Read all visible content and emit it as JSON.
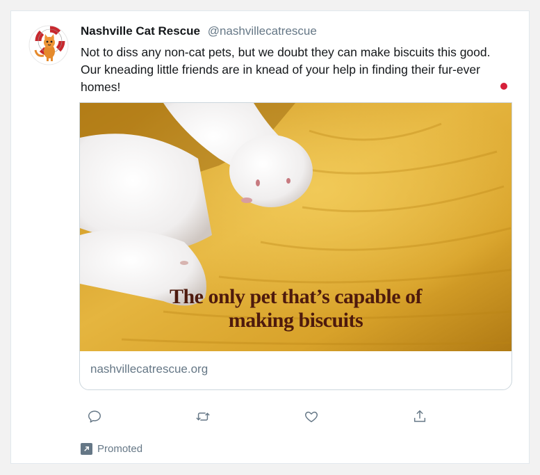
{
  "tweet": {
    "display_name": "Nashville Cat Rescue",
    "handle": "@nashvillecatrescue",
    "text": "Not to diss any non-cat pets, but we doubt they can make biscuits this good. Our kneading little friends are in knead of your help in finding their fur-ever homes!"
  },
  "card": {
    "overlay_line1": "The only pet that’s capable of",
    "overlay_line2": "making biscuits",
    "url": "nashvillecatrescue.org"
  },
  "promoted": {
    "label": "Promoted"
  },
  "icons": {
    "avatar": "cat-lifebuoy-logo",
    "reply": "reply-icon",
    "retweet": "retweet-icon",
    "like": "heart-icon",
    "share": "share-icon",
    "promoted": "promoted-arrow-icon"
  },
  "colors": {
    "name": "#14171a",
    "secondary_text": "#657786",
    "overlay_text": "#4e1a0d",
    "indicator_dot": "#d6203a",
    "border": "#e1e8ed"
  }
}
